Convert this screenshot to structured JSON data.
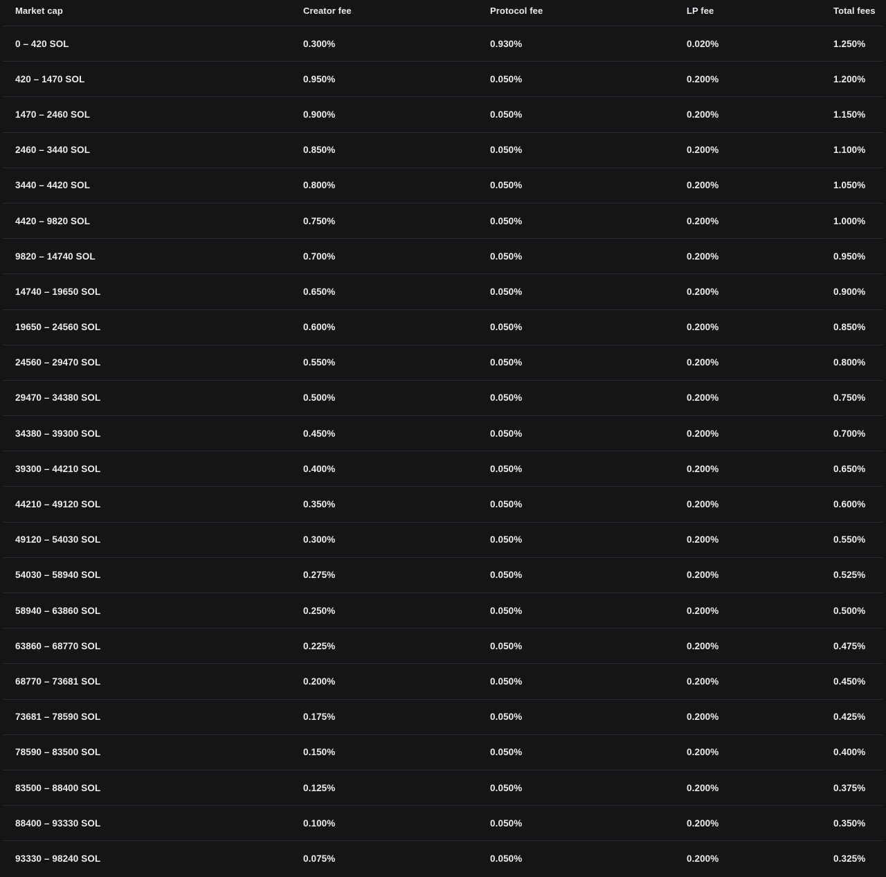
{
  "table": {
    "headers": [
      "Market cap",
      "Creator fee",
      "Protocol fee",
      "LP fee",
      "Total fees"
    ],
    "rows": [
      [
        "0 – 420 SOL",
        "0.300%",
        "0.930%",
        "0.020%",
        "1.250%"
      ],
      [
        "420 – 1470 SOL",
        "0.950%",
        "0.050%",
        "0.200%",
        "1.200%"
      ],
      [
        "1470 – 2460 SOL",
        "0.900%",
        "0.050%",
        "0.200%",
        "1.150%"
      ],
      [
        "2460 – 3440 SOL",
        "0.850%",
        "0.050%",
        "0.200%",
        "1.100%"
      ],
      [
        "3440 – 4420 SOL",
        "0.800%",
        "0.050%",
        "0.200%",
        "1.050%"
      ],
      [
        "4420 – 9820 SOL",
        "0.750%",
        "0.050%",
        "0.200%",
        "1.000%"
      ],
      [
        "9820 – 14740 SOL",
        "0.700%",
        "0.050%",
        "0.200%",
        "0.950%"
      ],
      [
        "14740 – 19650 SOL",
        "0.650%",
        "0.050%",
        "0.200%",
        "0.900%"
      ],
      [
        "19650 – 24560 SOL",
        "0.600%",
        "0.050%",
        "0.200%",
        "0.850%"
      ],
      [
        "24560 – 29470 SOL",
        "0.550%",
        "0.050%",
        "0.200%",
        "0.800%"
      ],
      [
        "29470 – 34380 SOL",
        "0.500%",
        "0.050%",
        "0.200%",
        "0.750%"
      ],
      [
        "34380 – 39300 SOL",
        "0.450%",
        "0.050%",
        "0.200%",
        "0.700%"
      ],
      [
        "39300 – 44210 SOL",
        "0.400%",
        "0.050%",
        "0.200%",
        "0.650%"
      ],
      [
        "44210 – 49120 SOL",
        "0.350%",
        "0.050%",
        "0.200%",
        "0.600%"
      ],
      [
        "49120 – 54030 SOL",
        "0.300%",
        "0.050%",
        "0.200%",
        "0.550%"
      ],
      [
        "54030 – 58940 SOL",
        "0.275%",
        "0.050%",
        "0.200%",
        "0.525%"
      ],
      [
        "58940 – 63860 SOL",
        "0.250%",
        "0.050%",
        "0.200%",
        "0.500%"
      ],
      [
        "63860 – 68770 SOL",
        "0.225%",
        "0.050%",
        "0.200%",
        "0.475%"
      ],
      [
        "68770 – 73681 SOL",
        "0.200%",
        "0.050%",
        "0.200%",
        "0.450%"
      ],
      [
        "73681 – 78590 SOL",
        "0.175%",
        "0.050%",
        "0.200%",
        "0.425%"
      ],
      [
        "78590 – 83500 SOL",
        "0.150%",
        "0.050%",
        "0.200%",
        "0.400%"
      ],
      [
        "83500 – 88400 SOL",
        "0.125%",
        "0.050%",
        "0.200%",
        "0.375%"
      ],
      [
        "88400 – 93330 SOL",
        "0.100%",
        "0.050%",
        "0.200%",
        "0.350%"
      ],
      [
        "93330 – 98240 SOL",
        "0.075%",
        "0.050%",
        "0.200%",
        "0.325%"
      ]
    ]
  },
  "colors": {
    "background": "#151517",
    "text": "#ececee",
    "divider": "#2b2b2f"
  }
}
